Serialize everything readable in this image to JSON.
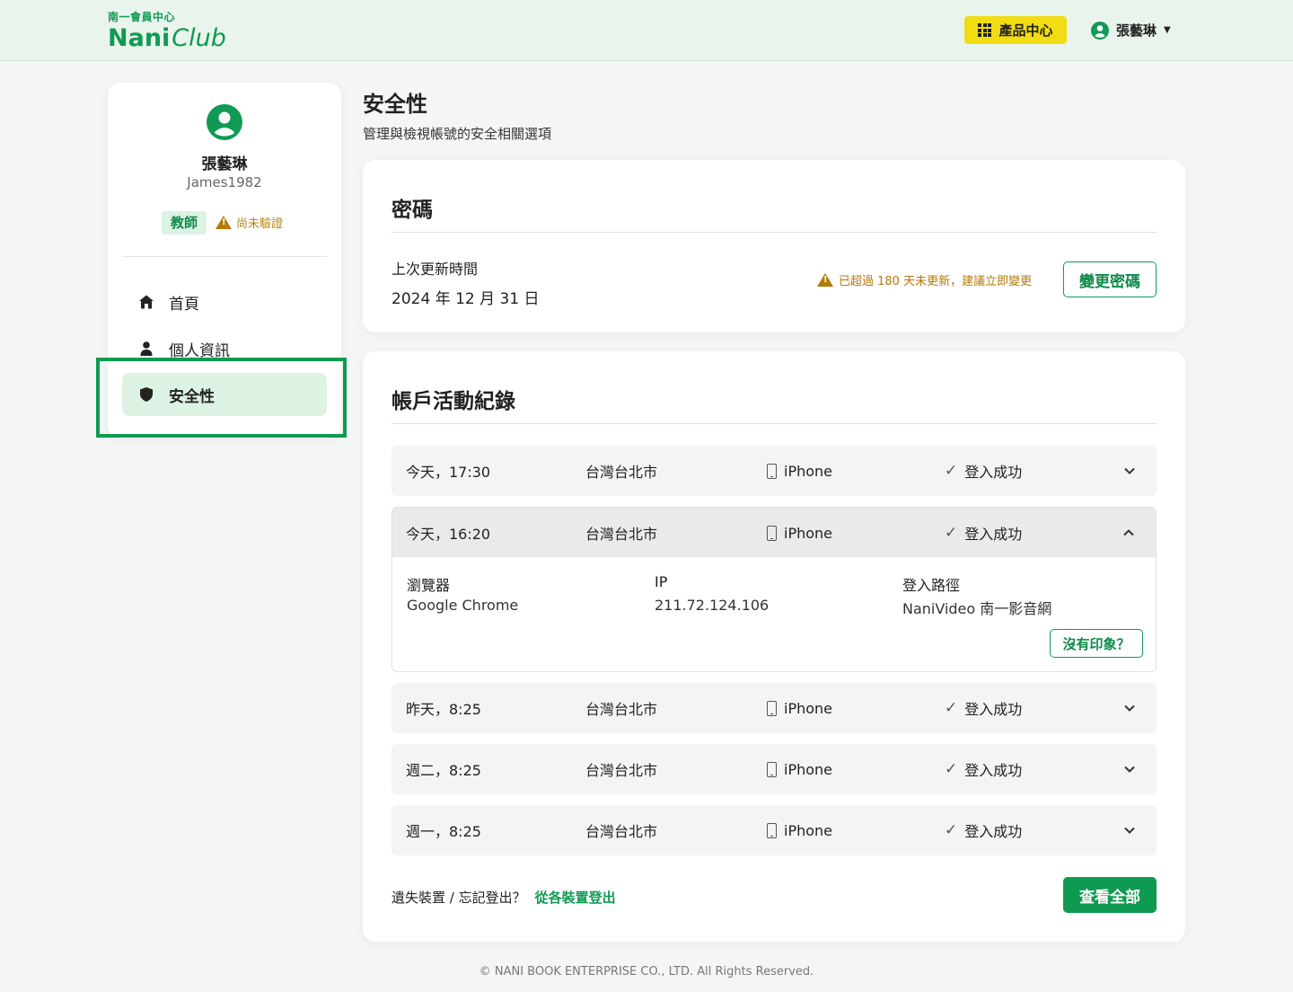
{
  "header": {
    "logo_sub": "南一會員中心",
    "logo_main": "Nani",
    "logo_club": "Club",
    "product_center": "產品中心",
    "user_name": "張藝琳"
  },
  "sidebar": {
    "name": "張藝琳",
    "username": "James1982",
    "role": "教師",
    "verify_status": "尚未驗證",
    "items": [
      {
        "label": "首頁",
        "icon": "home-icon"
      },
      {
        "label": "個人資訊",
        "icon": "person-icon"
      },
      {
        "label": "安全性",
        "icon": "shield-icon",
        "active": true
      }
    ]
  },
  "page": {
    "title": "安全性",
    "subtitle": "管理與檢視帳號的安全相關選項"
  },
  "password": {
    "title": "密碼",
    "last_updated_label": "上次更新時間",
    "last_updated_value": "2024 年 12 月 31 日",
    "warning": "已超過 180 天未更新，建議立即變更",
    "change_button": "變更密碼"
  },
  "activity": {
    "title": "帳戶活動紀錄",
    "rows": [
      {
        "time": "今天，17:30",
        "location": "台灣台北市",
        "device": "iPhone",
        "status": "登入成功",
        "expanded": false
      },
      {
        "time": "今天，16:20",
        "location": "台灣台北市",
        "device": "iPhone",
        "status": "登入成功",
        "expanded": true
      },
      {
        "time": "昨天，8:25",
        "location": "台灣台北市",
        "device": "iPhone",
        "status": "登入成功",
        "expanded": false
      },
      {
        "time": "週二，8:25",
        "location": "台灣台北市",
        "device": "iPhone",
        "status": "登入成功",
        "expanded": false
      },
      {
        "time": "週一，8:25",
        "location": "台灣台北市",
        "device": "iPhone",
        "status": "登入成功",
        "expanded": false
      }
    ],
    "detail": {
      "browser_label": "瀏覽器",
      "browser_value": "Google Chrome",
      "ip_label": "IP",
      "ip_value": "211.72.124.106",
      "route_label": "登入路徑",
      "route_value": "NaniVideo 南一影音網",
      "not_me_button": "沒有印象？"
    },
    "lost_text": "遺失裝置 / 忘記登出？",
    "logout_all_link": "從各裝置登出",
    "view_all_button": "查看全部"
  },
  "footer": "© NANI BOOK ENTERPRISE CO., LTD. All Rights Reserved.",
  "colors": {
    "brand_green": "#0f9a52",
    "header_bg": "#e9f5ec",
    "product_button": "#f2dc13",
    "warning": "#b5780a",
    "active_nav_bg": "#dcf3e4",
    "highlight_box": "#0c9b4f"
  }
}
